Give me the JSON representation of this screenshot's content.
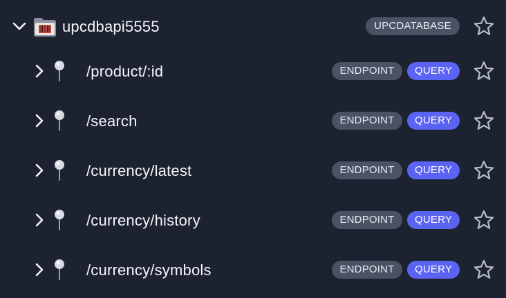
{
  "root": {
    "label": "upcdbapi5555",
    "badge": "UPCDATABASE",
    "icon": "folder-icon",
    "expanded": true
  },
  "endpoints": [
    {
      "path": "/product/:id",
      "badges": [
        "ENDPOINT",
        "QUERY"
      ]
    },
    {
      "path": "/search",
      "badges": [
        "ENDPOINT",
        "QUERY"
      ]
    },
    {
      "path": "/currency/latest",
      "badges": [
        "ENDPOINT",
        "QUERY"
      ]
    },
    {
      "path": "/currency/history",
      "badges": [
        "ENDPOINT",
        "QUERY"
      ]
    },
    {
      "path": "/currency/symbols",
      "badges": [
        "ENDPOINT",
        "QUERY"
      ]
    }
  ],
  "colors": {
    "background": "#1d2230",
    "gray_badge": "#4a5264",
    "blue_badge": "#5a63f2",
    "text": "#f4f6fb",
    "star_outline": "#b9bec9"
  }
}
